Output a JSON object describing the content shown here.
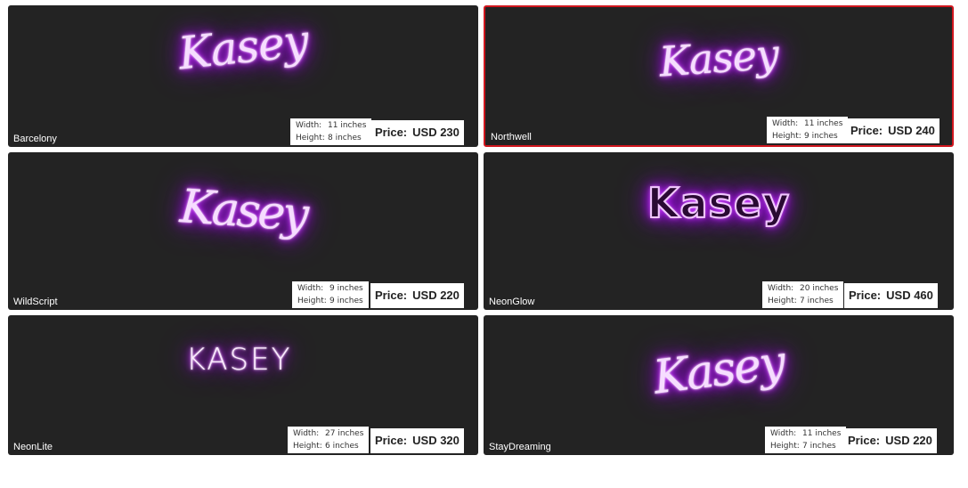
{
  "accent": {
    "glow_color": "#b21aff",
    "card_bg": "#232323",
    "selected_border": "#d0161e"
  },
  "labels": {
    "width": "Width:",
    "height": "Height:",
    "price": "Price:"
  },
  "cards": [
    {
      "style": "Barcelony",
      "preview_text": "Kasey",
      "width": "11 inches",
      "height": "8 inches",
      "price": "USD 230",
      "selected": false
    },
    {
      "style": "Northwell",
      "preview_text": "Kasey",
      "width": "11 inches",
      "height": "9 inches",
      "price": "USD 240",
      "selected": true
    },
    {
      "style": "WildScript",
      "preview_text": "Kasey",
      "width": "9 inches",
      "height": "9 inches",
      "price": "USD 220",
      "selected": false
    },
    {
      "style": "NeonGlow",
      "preview_text": "Kasey",
      "width": "20 inches",
      "height": "7 inches",
      "price": "USD 460",
      "selected": false
    },
    {
      "style": "NeonLite",
      "preview_text": "KASEY",
      "width": "27 inches",
      "height": "6 inches",
      "price": "USD 320",
      "selected": false
    },
    {
      "style": "StayDreaming",
      "preview_text": "Kasey",
      "width": "11 inches",
      "height": "7 inches",
      "price": "USD 220",
      "selected": false
    }
  ]
}
